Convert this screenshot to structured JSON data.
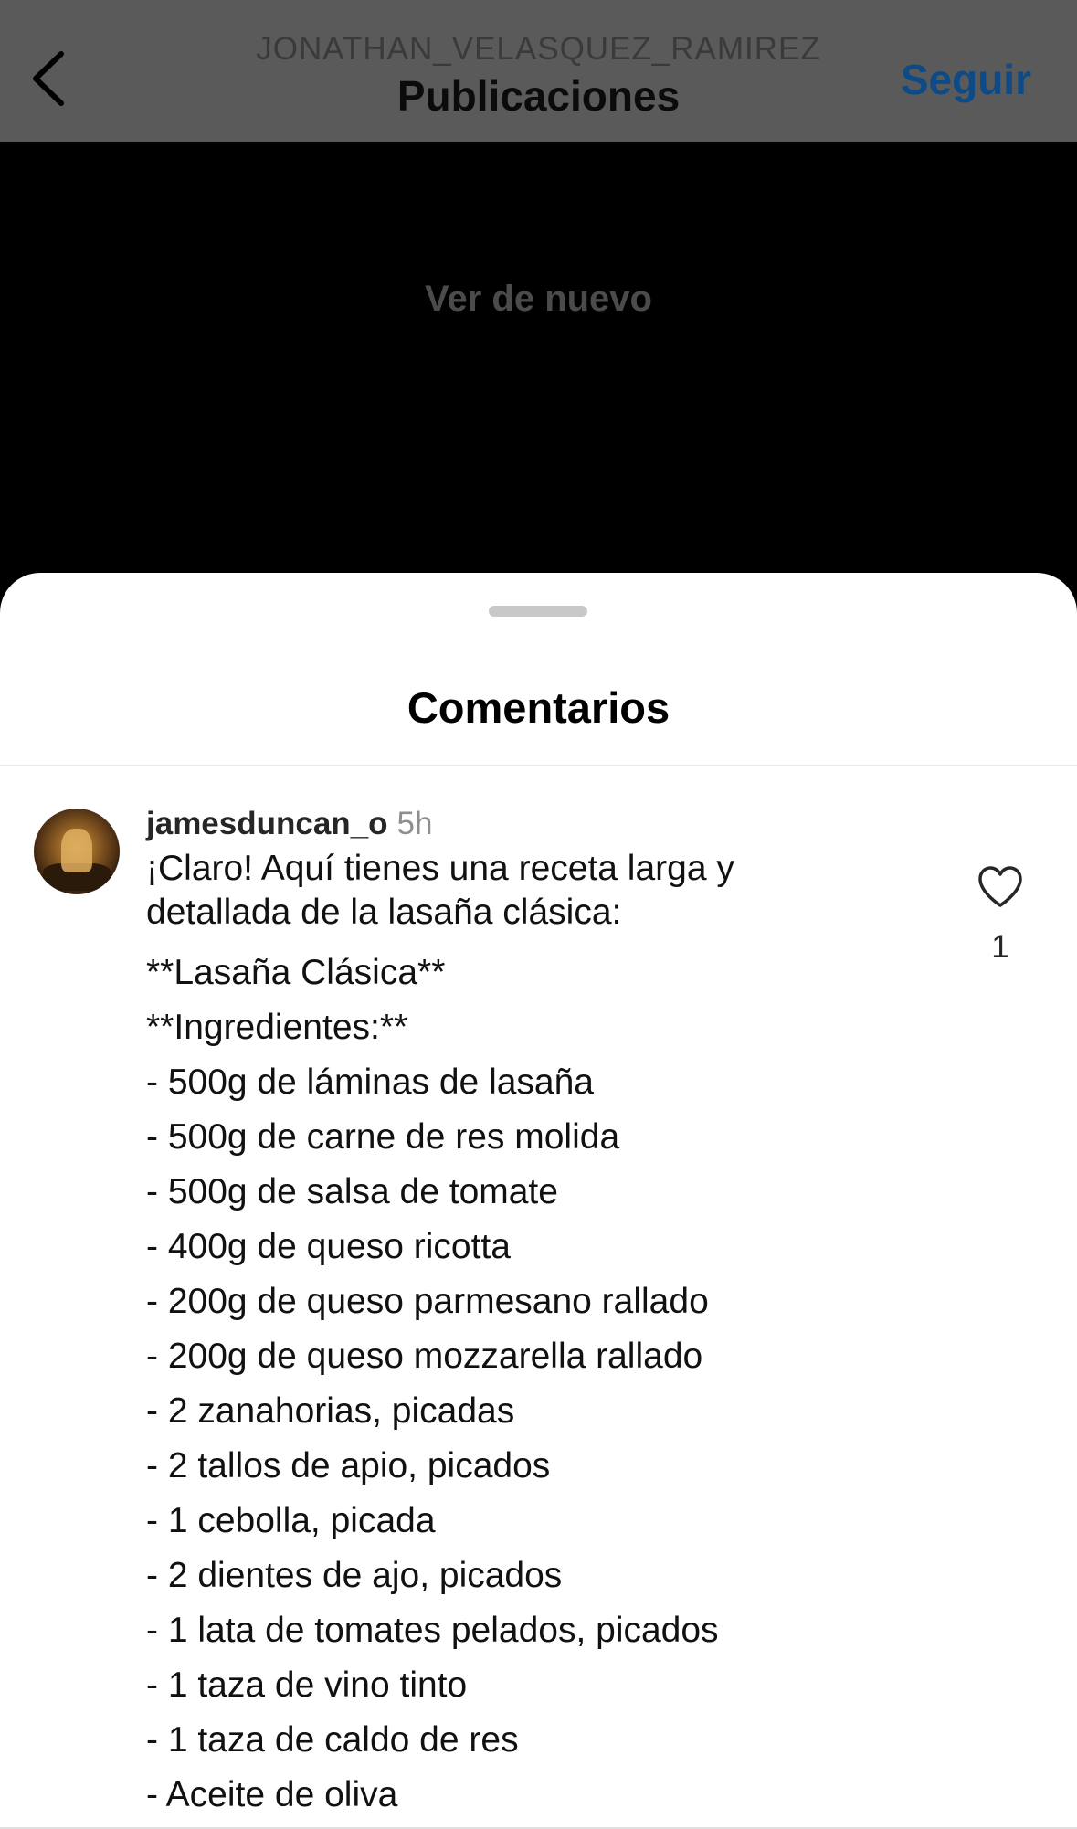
{
  "header": {
    "username": "JONATHAN_VELASQUEZ_RAMIREZ",
    "title": "Publicaciones",
    "follow_label": "Seguir"
  },
  "video": {
    "watch_again_label": "Ver de nuevo"
  },
  "comments_sheet": {
    "title": "Comentarios",
    "comment": {
      "username": "jamesduncan_o",
      "time": "5h",
      "intro": "¡Claro! Aquí tienes una receta larga y detallada de la lasaña clásica:",
      "lines": [
        "**Lasaña Clásica**",
        "**Ingredientes:**",
        "- 500g de láminas de lasaña",
        "- 500g de carne de res molida",
        "- 500g de salsa de tomate",
        "- 400g de queso ricotta",
        "- 200g de queso parmesano rallado",
        "- 200g de queso mozzarella rallado",
        "- 2 zanahorias, picadas",
        "- 2 tallos de apio, picados",
        "- 1 cebolla, picada",
        "- 2 dientes de ajo, picados",
        "- 1 lata de tomates pelados, picados",
        "- 1 taza de vino tinto",
        "- 1 taza de caldo de res",
        "- Aceite de oliva"
      ],
      "like_count": "1"
    }
  },
  "colors": {
    "follow": "#0e4b86",
    "header_bg": "#5a5a5a"
  }
}
